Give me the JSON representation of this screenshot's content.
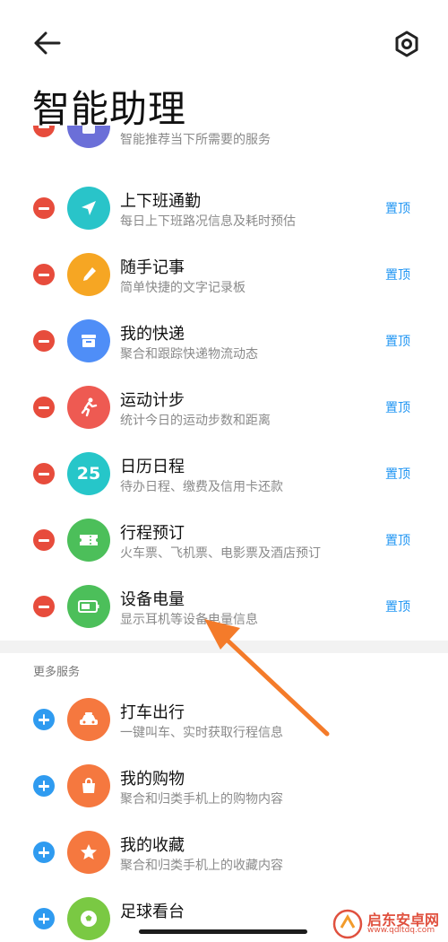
{
  "header": {
    "title": "智能助理"
  },
  "pinned_items": [
    {
      "title": "",
      "subtitle": "智能推荐当下所需要的服务",
      "icon": "suggestion-card-icon",
      "color": "#6b6fd8"
    },
    {
      "title": "上下班通勤",
      "subtitle": "每日上下班路况信息及耗时预估",
      "pin": "置顶",
      "icon": "navigation-arrow-icon",
      "color": "#29c4c9"
    },
    {
      "title": "随手记事",
      "subtitle": "简单快捷的文字记录板",
      "pin": "置顶",
      "icon": "pencil-icon",
      "color": "#f6a623"
    },
    {
      "title": "我的快递",
      "subtitle": "聚合和跟踪快递物流动态",
      "pin": "置顶",
      "icon": "package-icon",
      "color": "#4f8ef7"
    },
    {
      "title": "运动计步",
      "subtitle": "统计今日的运动步数和距离",
      "pin": "置顶",
      "icon": "running-person-icon",
      "color": "#ee5a52"
    },
    {
      "title": "日历日程",
      "subtitle": "待办日程、缴费及信用卡还款",
      "pin": "置顶",
      "icon": "calendar-icon",
      "icon_text": "25",
      "color": "#26c6c9"
    },
    {
      "title": "行程预订",
      "subtitle": "火车票、飞机票、电影票及酒店预订",
      "pin": "置顶",
      "icon": "ticket-icon",
      "color": "#4cbf5a"
    },
    {
      "title": "设备电量",
      "subtitle": "显示耳机等设备电量信息",
      "pin": "置顶",
      "icon": "battery-icon",
      "color": "#4cbf5a"
    }
  ],
  "more_section": {
    "label": "更多服务",
    "items": [
      {
        "title": "打车出行",
        "subtitle": "一键叫车、实时获取行程信息",
        "icon": "taxi-icon",
        "color": "#f5783f"
      },
      {
        "title": "我的购物",
        "subtitle": "聚合和归类手机上的购物内容",
        "icon": "shopping-bag-icon",
        "color": "#f5783f"
      },
      {
        "title": "我的收藏",
        "subtitle": "聚合和归类手机上的收藏内容",
        "icon": "star-icon",
        "color": "#f5783f"
      },
      {
        "title": "足球看台",
        "subtitle": "",
        "icon": "soccer-ball-icon",
        "color": "#7ac943"
      }
    ]
  },
  "watermark": {
    "text": "启东安卓网",
    "url": "www.qdltdq.com"
  }
}
